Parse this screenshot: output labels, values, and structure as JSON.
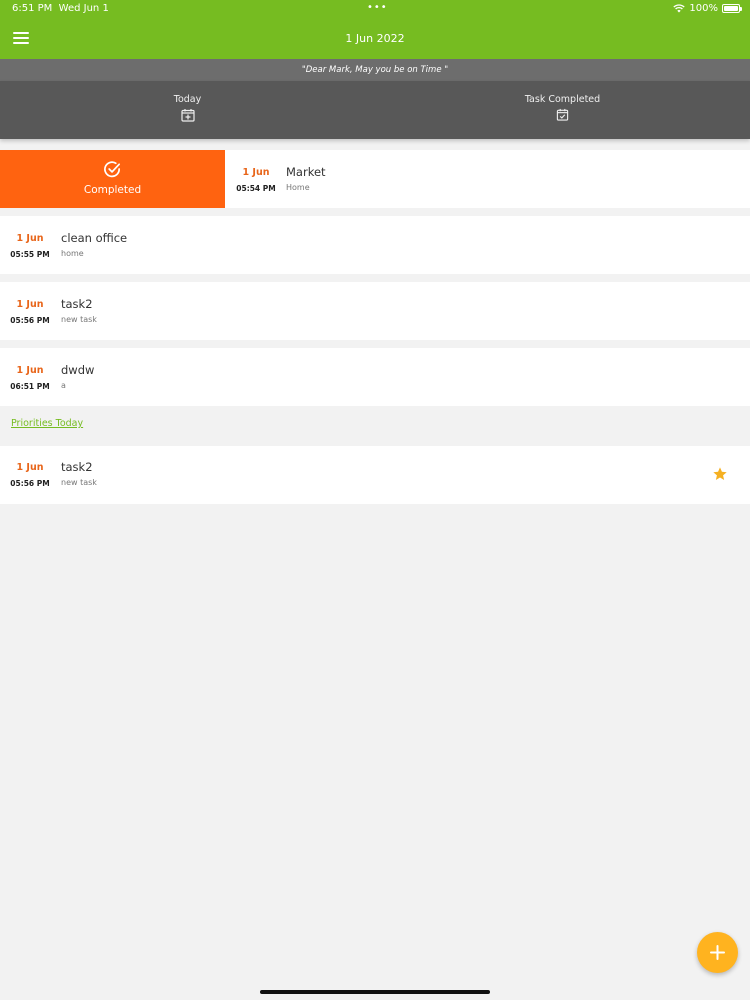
{
  "status_bar": {
    "time": "6:51 PM",
    "date": "Wed Jun 1",
    "dots": "•••",
    "battery": "100%"
  },
  "header": {
    "title": "1 Jun 2022"
  },
  "quote": "\"Dear Mark, May you be on Time \"",
  "tabs": [
    {
      "label": "Today"
    },
    {
      "label": "Task Completed"
    }
  ],
  "swipe_action": {
    "label": "Completed"
  },
  "tasks": [
    {
      "date": "1 Jun",
      "time": "05:54 PM",
      "title": "Market",
      "category": "Home"
    },
    {
      "date": "1 Jun",
      "time": "05:55 PM",
      "title": "clean office",
      "category": "home"
    },
    {
      "date": "1 Jun",
      "time": "05:56 PM",
      "title": "task2",
      "category": "new task"
    },
    {
      "date": "1 Jun",
      "time": "06:51 PM",
      "title": "dwdw",
      "category": "a"
    }
  ],
  "priorities": {
    "label": "Priorities Today",
    "items": [
      {
        "date": "1 Jun",
        "time": "05:56 PM",
        "title": "task2",
        "category": "new task"
      }
    ]
  },
  "colors": {
    "primary_green": "#76bc21",
    "accent_orange": "#ff6310",
    "date_orange": "#e8651a",
    "fab_yellow": "#ffb31f",
    "star_yellow": "#f5b021"
  }
}
